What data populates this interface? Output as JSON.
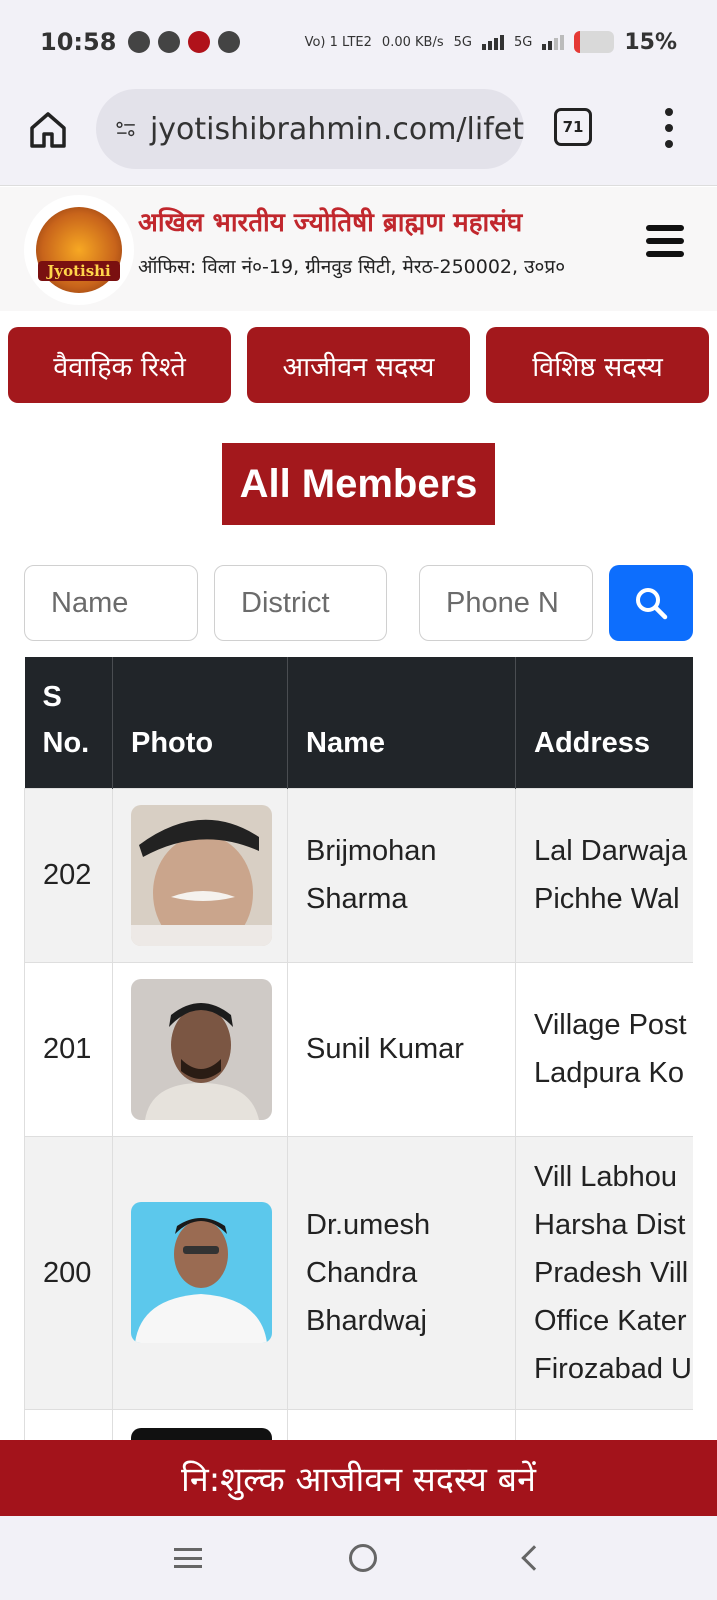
{
  "status_bar": {
    "time": "10:58",
    "network": "Vo) 1 LTE2",
    "speed": "0.00 KB/s",
    "sig1": "5G",
    "sig2": "5G",
    "battery": "15%"
  },
  "browser": {
    "url": "jyotishibrahmin.com/lifet",
    "tab_count": "71"
  },
  "site": {
    "logo_text": "Jyotishi",
    "title": "अखिल भारतीय ज्योतिषी ब्राह्मण महासंघ",
    "address": "ऑफिस: विला नं०-19, ग्रीनवुड सिटी, मेरठ-250002, उ०प्र०"
  },
  "categories": [
    "वैवाहिक रिश्ते",
    "आजीवन सदस्य",
    "विशिष्ठ सदस्य"
  ],
  "heading": "All Members",
  "filters": {
    "name_placeholder": "Name",
    "district_placeholder": "District",
    "phone_placeholder": "Phone N"
  },
  "table": {
    "headers": [
      "S No.",
      "Photo",
      "Name",
      "Address"
    ],
    "rows": [
      {
        "sno": "202",
        "name_lines": [
          "Brijmohan",
          "Sharma"
        ],
        "address_lines": [
          "Lal Darwaja",
          "Pichhe Wal"
        ]
      },
      {
        "sno": "201",
        "name_lines": [
          "Sunil Kumar"
        ],
        "address_lines": [
          "Village Post",
          "Ladpura Ko"
        ]
      },
      {
        "sno": "200",
        "name_lines": [
          "Dr.umesh",
          "Chandra",
          "Bhardwaj"
        ],
        "address_lines": [
          "Vill Labhou",
          "Harsha Dist",
          "Pradesh Vill",
          "Office Kater",
          "Firozabad U"
        ]
      }
    ]
  },
  "banner": "नि:शुल्क आजीवन सदस्य बनें",
  "colors": {
    "brand_red": "#a3181c",
    "search_blue": "#0d6efd",
    "table_header": "#212529"
  }
}
